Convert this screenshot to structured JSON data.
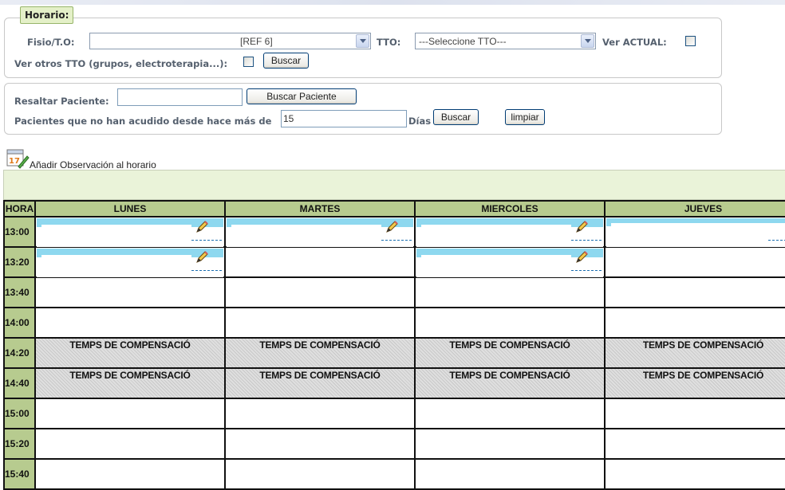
{
  "filters": {
    "legend": "Horario:",
    "fisio_label": "Fisio/T.O:",
    "fisio_value": "[REF 6]",
    "tto_label": "TTO:",
    "tto_value": "---Seleccione TTO---",
    "ver_actual_label": "Ver ACTUAL:",
    "ver_otros_label": "Ver otros TTO (grupos, electroterapia...):",
    "buscar_label": "Buscar"
  },
  "patient": {
    "resaltar_label": "Resaltar Paciente:",
    "resaltar_value": "",
    "buscar_paciente_label": "Buscar Paciente",
    "no_acudido_label": "Pacientes que no han acudido desde hace más de",
    "dias_value": "15",
    "dias_label": "Días",
    "buscar_label": "Buscar",
    "limpiar_label": "limpiar"
  },
  "observacion": {
    "icon": "calendar-edit-icon",
    "label": "Añadir Observación al horario"
  },
  "schedule": {
    "hora_header": "HORA",
    "days": [
      "LUNES",
      "MARTES",
      "MIERCOLES",
      "JUEVES"
    ],
    "rows": [
      {
        "time": "13:00",
        "cells": [
          "appt",
          "appt",
          "appt",
          "appt"
        ]
      },
      {
        "time": "13:20",
        "cells": [
          "appt",
          "",
          "appt",
          ""
        ]
      },
      {
        "time": "13:40",
        "cells": [
          "",
          "",
          "",
          ""
        ]
      },
      {
        "time": "14:00",
        "cells": [
          "",
          "",
          "",
          ""
        ]
      },
      {
        "time": "14:20",
        "cells": [
          "TEMPS DE COMPENSACIÓ",
          "TEMPS DE COMPENSACIÓ",
          "TEMPS DE COMPENSACIÓ",
          "TEMPS DE COMPENSACIÓ"
        ]
      },
      {
        "time": "14:40",
        "cells": [
          "TEMPS DE COMPENSACIÓ",
          "TEMPS DE COMPENSACIÓ",
          "TEMPS DE COMPENSACIÓ",
          "TEMPS DE COMPENSACIÓ"
        ]
      },
      {
        "time": "15:00",
        "cells": [
          "",
          "",
          "",
          ""
        ]
      },
      {
        "time": "15:20",
        "cells": [
          "",
          "",
          "",
          ""
        ]
      },
      {
        "time": "15:40",
        "cells": [
          "",
          "",
          "",
          ""
        ]
      }
    ]
  },
  "colors": {
    "header_green": "#b7cb8f",
    "appt_band": "#8ed8ef",
    "legend_bg": "#e4f0c8"
  }
}
